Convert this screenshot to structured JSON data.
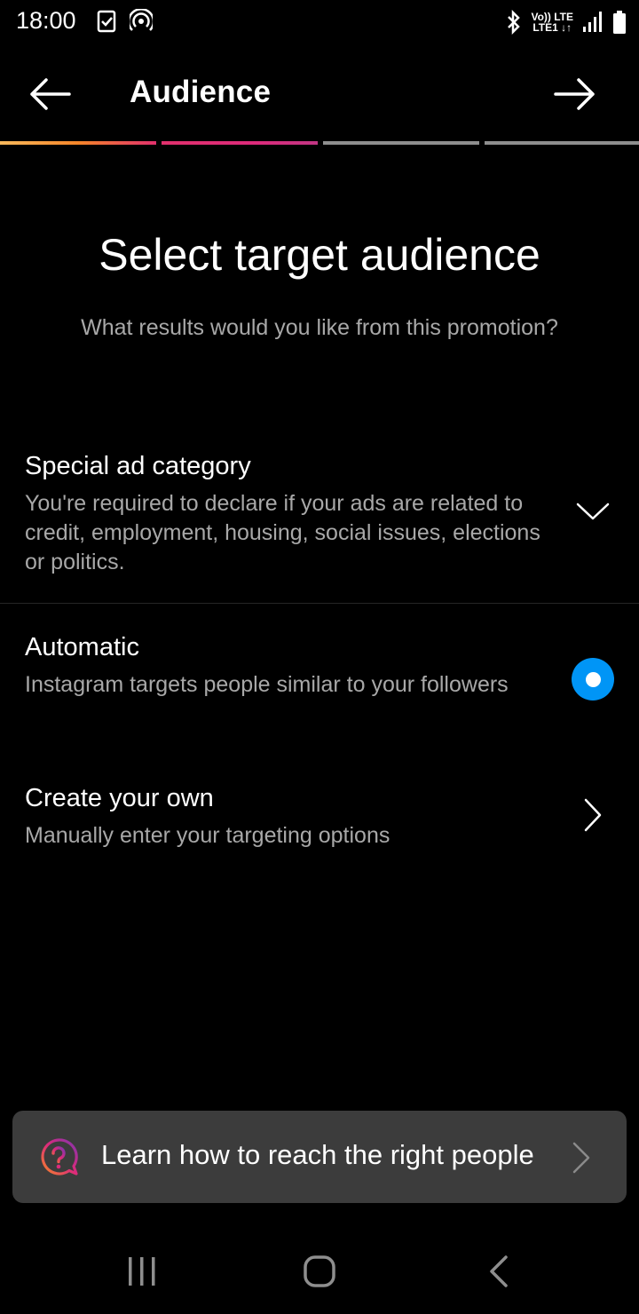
{
  "status_bar": {
    "time": "18:00",
    "net_top": "Vo)) LTE",
    "net_bottom": "LTE1 ↓↑"
  },
  "header": {
    "title": "Audience",
    "back_icon": "arrow-left-icon",
    "next_icon": "arrow-right-icon"
  },
  "progress": {
    "segments": 4,
    "active_segments": 2,
    "colors": {
      "step1": "#f58529",
      "step2": "#dd2a7b",
      "inactive": "#8e8e8e"
    }
  },
  "main": {
    "heading": "Select target audience",
    "subtitle": "What results would you like from this promotion?"
  },
  "options": {
    "special": {
      "title": "Special ad category",
      "desc": "You're required to declare if your ads are related to credit, employment, housing, social issues, elections or politics."
    },
    "automatic": {
      "title": "Automatic",
      "desc": "Instagram targets people similar to your followers",
      "selected": true
    },
    "custom": {
      "title": "Create your own",
      "desc": "Manually enter your targeting options"
    }
  },
  "banner": {
    "text": "Learn how to reach the right people",
    "icon": "question-bubble-icon"
  },
  "accent_color": "#0095f6"
}
